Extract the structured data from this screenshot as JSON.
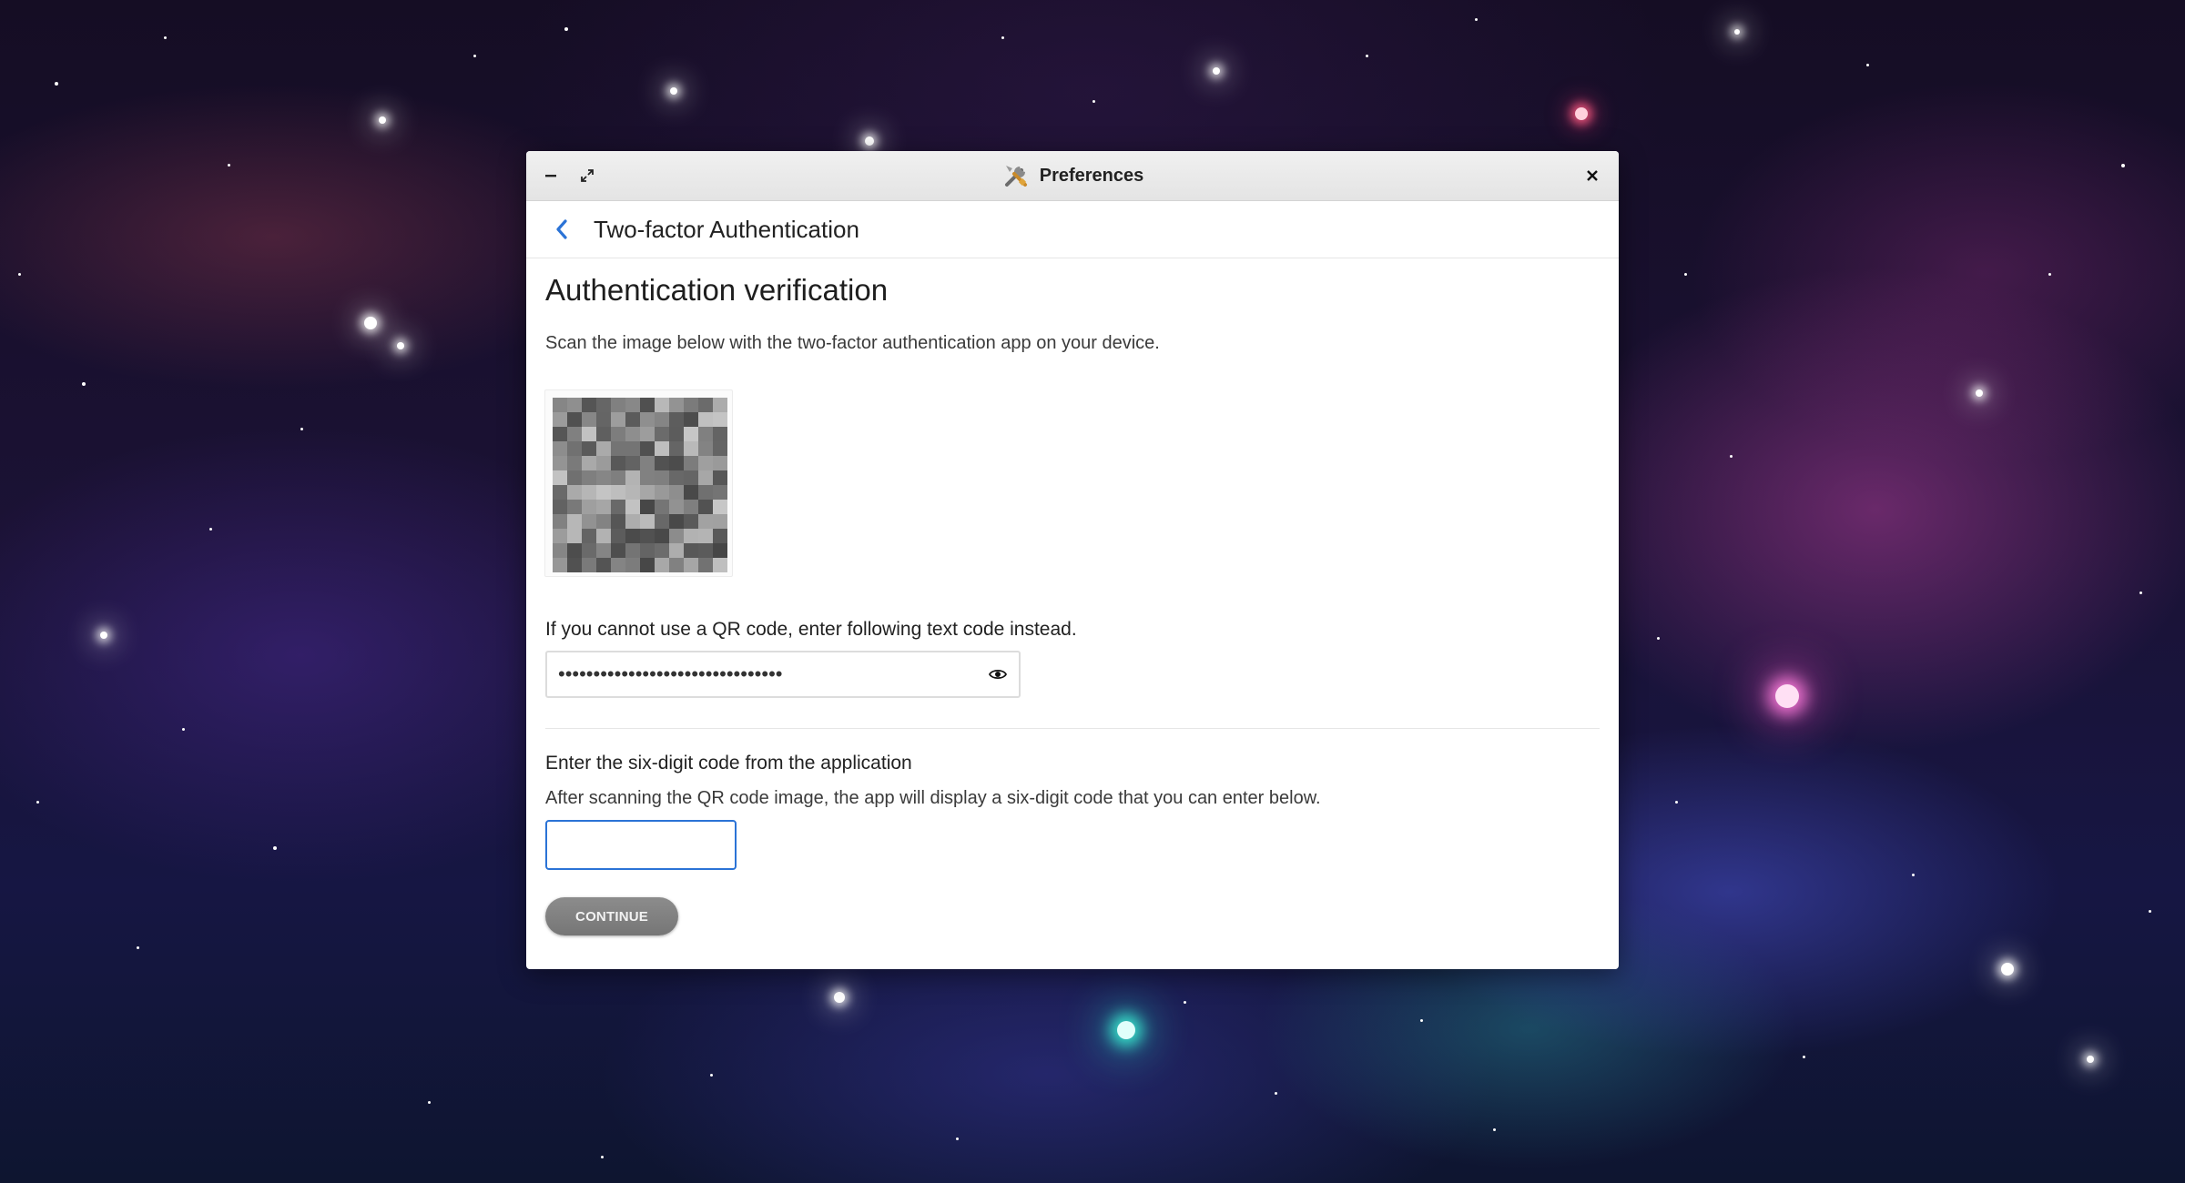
{
  "window": {
    "title": "Preferences",
    "icon": "tools-icon"
  },
  "titlebar": {
    "minimize_icon": "minimize-icon",
    "maximize_icon": "expand-icon",
    "close_icon": "close-icon"
  },
  "nav": {
    "back_icon": "chevron-left-icon",
    "title": "Two-factor Authentication"
  },
  "verification": {
    "heading": "Authentication verification",
    "scan_instruction": "Scan the image below with the two-factor authentication app on your device.",
    "qr_code": "pixelated-qr-code-image",
    "text_code_label": "If you cannot use a QR code, enter following text code instead.",
    "text_code_masked": "••••••••••••••••••••••••••••••••",
    "reveal_icon": "eye-icon"
  },
  "six_digit": {
    "label": "Enter the six-digit code from the application",
    "instruction": "After scanning the QR code image, the app will display a six-digit code that you can enter below.",
    "value": ""
  },
  "actions": {
    "continue_label": "CONTINUE"
  },
  "colors": {
    "accent": "#2b73d6",
    "back_chevron": "#2b73d6",
    "button_bg": "#808080",
    "button_text": "#f2f2f2"
  }
}
